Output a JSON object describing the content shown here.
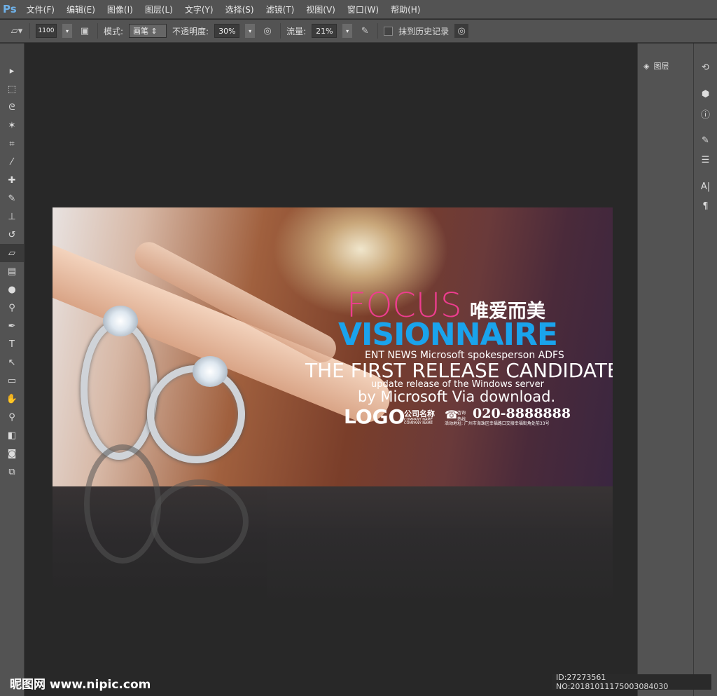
{
  "app": {
    "logo": "Ps"
  },
  "menu": [
    "文件(F)",
    "编辑(E)",
    "图像(I)",
    "图层(L)",
    "文字(Y)",
    "选择(S)",
    "滤镜(T)",
    "视图(V)",
    "窗口(W)",
    "帮助(H)"
  ],
  "options": {
    "brush_size": "1100",
    "mode_label": "模式:",
    "mode_value": "画笔",
    "opacity_label": "不透明度:",
    "opacity_value": "30%",
    "flow_label": "流量:",
    "flow_value": "21%",
    "history_label": "抹到历史记录"
  },
  "panel": {
    "layers_label": "图层"
  },
  "banner": {
    "focus": "FOCUS",
    "cn_title": "唯爱而美",
    "visionnaire": "VISIONNAIRE",
    "ent_news": "ENT NEWS Microsoft spokesperson ADFS",
    "release": "THE FIRST RELEASE CANDIDATE",
    "update": "update release of the Windows server",
    "by": "by Microsoft Via download.",
    "logo": "LOGO",
    "company_cn": "公司名称",
    "company_en1": "COMPANY NAME",
    "company_en2": "COMPANY NAME",
    "consult": "咨询热线",
    "phone": "020-8888888",
    "address": "活动地址: 广州市海珠区幸福路口交接幸福街角处前33号",
    "colors": {
      "focus": "#ee3d8f",
      "visionnaire": "#1aa3ec"
    }
  },
  "watermark": {
    "site": "昵图网 www.nipic.com",
    "id": "ID:27273561 NO:20181011175003084030"
  }
}
